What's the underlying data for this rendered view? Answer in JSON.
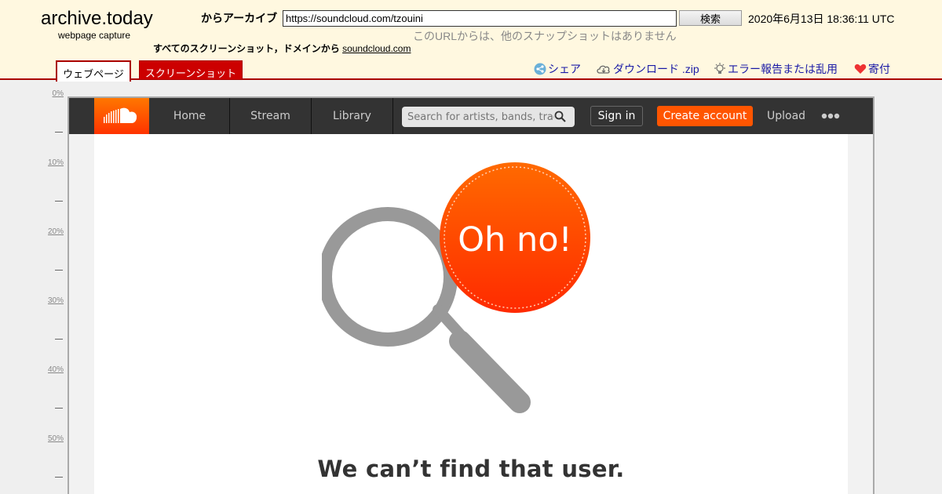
{
  "archive": {
    "title": "archive.today",
    "subtitle": "webpage capture",
    "from_label": "からアーカイブ",
    "url": "https://soundcloud.com/tzouini",
    "search_label": "検索",
    "date": "2020年6月13日 18:36:11 UTC",
    "no_snapshots": "このURLからは、他のスナップショットはありません",
    "all_screenshots_label": "すべてのスクリーンショット，ドメインから",
    "domain_link": "soundcloud.com",
    "tabs": {
      "webpage": "ウェブページ",
      "screenshot": "スクリーンショット"
    },
    "links": {
      "share": "シェア",
      "download": "ダウンロード .zip",
      "report": "エラー報告または乱用",
      "donate": "寄付"
    },
    "ruler": [
      "0%",
      "10%",
      "20%",
      "30%",
      "40%",
      "50%"
    ]
  },
  "soundcloud": {
    "nav": {
      "home": "Home",
      "stream": "Stream",
      "library": "Library"
    },
    "search_placeholder": "Search for artists, bands, tracks, podcasts",
    "sign_in": "Sign in",
    "create_account": "Create account",
    "upload": "Upload",
    "badge_text": "Oh no!",
    "error_message": "We can’t find that user.",
    "colors": {
      "brand": "#ff5500",
      "nav_bg": "#333333"
    }
  }
}
